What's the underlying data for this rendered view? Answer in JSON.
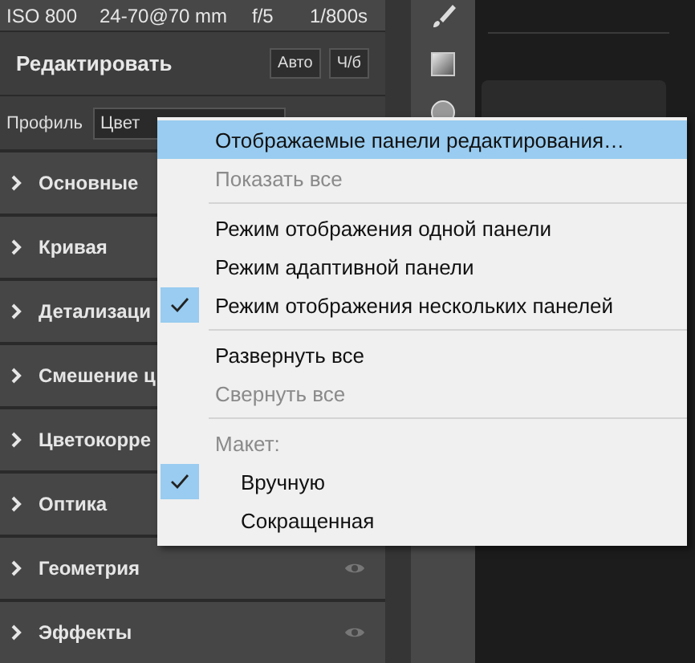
{
  "info_bar": [
    "ISO 800",
    "24-70@70 mm",
    "f/5",
    "1/800s"
  ],
  "panel": {
    "title": "Редактировать",
    "buttons": [
      "Авто",
      "Ч/б"
    ],
    "profile": {
      "label": "Профиль",
      "value": "Цвет"
    }
  },
  "sections": [
    {
      "label": "Основные"
    },
    {
      "label": "Кривая"
    },
    {
      "label": "Детализаци"
    },
    {
      "label": "Смешение ц"
    },
    {
      "label": "Цветокорре"
    },
    {
      "label": "Оптика"
    },
    {
      "label": "Геометрия",
      "eye": true
    },
    {
      "label": "Эффекты",
      "eye": true
    }
  ],
  "menu": [
    {
      "kind": "item",
      "label": "Отображаемые панели редактирования…",
      "selected": true,
      "disabled": false,
      "checked": false
    },
    {
      "kind": "item",
      "label": "Показать все",
      "selected": false,
      "disabled": true,
      "checked": false
    },
    {
      "kind": "separator"
    },
    {
      "kind": "item",
      "label": "Режим отображения одной панели",
      "selected": false,
      "disabled": false,
      "checked": false
    },
    {
      "kind": "item",
      "label": "Режим адаптивной панели",
      "selected": false,
      "disabled": false,
      "checked": false
    },
    {
      "kind": "item",
      "label": "Режим отображения нескольких панелей",
      "selected": false,
      "disabled": false,
      "checked": true
    },
    {
      "kind": "separator"
    },
    {
      "kind": "item",
      "label": "Развернуть все",
      "selected": false,
      "disabled": false,
      "checked": false
    },
    {
      "kind": "item",
      "label": "Свернуть все",
      "selected": false,
      "disabled": true,
      "checked": false
    },
    {
      "kind": "separator"
    },
    {
      "kind": "group",
      "label": "Макет:",
      "children": [
        {
          "kind": "item",
          "label": "Вручную",
          "selected": false,
          "disabled": false,
          "checked": true
        },
        {
          "kind": "item",
          "label": "Сокращенная",
          "selected": false,
          "disabled": false,
          "checked": false
        }
      ]
    }
  ]
}
